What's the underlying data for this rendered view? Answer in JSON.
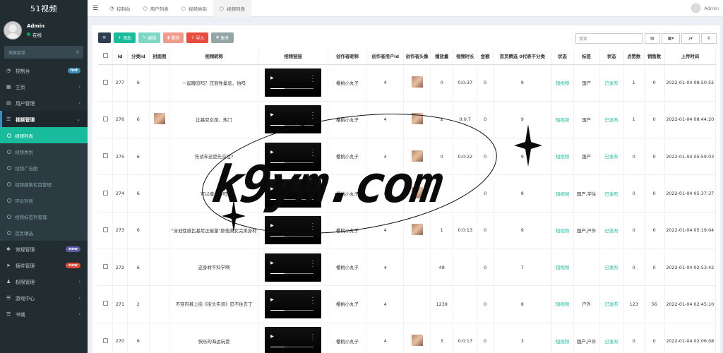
{
  "app": {
    "title": "51视频"
  },
  "user": {
    "name": "Admin",
    "status": "在线"
  },
  "sidebar": {
    "search_placeholder": "搜索菜单",
    "items": [
      {
        "label": "控制台",
        "badge": "hot",
        "icon": "dashboard-icon"
      },
      {
        "label": "主页",
        "icon": "home-icon"
      },
      {
        "label": "用户管理",
        "icon": "users-icon"
      },
      {
        "label": "视频管理",
        "icon": "list-icon"
      }
    ],
    "submenu": [
      "视频列表",
      "视频类别",
      "视频广告图",
      "视频搜索栏目管理",
      "评论列表",
      "视频标签列管理",
      "首页精选"
    ],
    "bottom_items": [
      {
        "label": "常规管理",
        "badge": "new"
      },
      {
        "label": "插件管理",
        "badge": "new"
      },
      {
        "label": "权限管理"
      },
      {
        "label": "游戏中心"
      },
      {
        "label": "书城"
      }
    ]
  },
  "topbar": {
    "tabs": [
      "控制台",
      "用户列表",
      "视频类别",
      "视频列表"
    ],
    "user": "Admin"
  },
  "toolbar": {
    "add": "添加",
    "edit": "编辑",
    "delete": "删除",
    "import": "导入",
    "more": "更多",
    "search_placeholder": "搜索"
  },
  "table": {
    "headers": [
      "Id",
      "分类id",
      "封面图",
      "视频昵称",
      "视频链接",
      "创作者昵称",
      "创作者用户id",
      "创作者头像",
      "播放量",
      "视频时长",
      "金额",
      "首页精选 0代表不分类",
      "状态",
      "标签",
      "状态",
      "点赞数",
      "销售数",
      "上传时间"
    ],
    "rows": [
      {
        "id": "277",
        "cat": "6",
        "cover": false,
        "title": "一起瞳览吗？压到性量息，怕吗",
        "creator": "樱桃小丸子",
        "uid": "4",
        "avatar": true,
        "plays": "0",
        "duration": "0:0:37",
        "amount": "0",
        "featured": "9",
        "status": "短视频",
        "tags": "国产",
        "pub": "已发布",
        "likes": "1",
        "sales": "0",
        "time": "2022-01-04 08:50:52"
      },
      {
        "id": "276",
        "cat": "6",
        "cover": true,
        "title": "比基尼女孩，热门",
        "creator": "樱桃小丸子",
        "uid": "4",
        "avatar": true,
        "plays": "2",
        "duration": "0:0:7",
        "amount": "0",
        "featured": "9",
        "status": "短视频",
        "tags": "国产",
        "pub": "已发布",
        "likes": "1",
        "sales": "0",
        "time": "2022-01-04 08:44:20"
      },
      {
        "id": "275",
        "cat": "6",
        "cover": false,
        "title": "先试车还是先交往?",
        "creator": "樱桃小丸子",
        "uid": "4",
        "avatar": true,
        "plays": "0",
        "duration": "0:0:22",
        "amount": "0",
        "featured": "9",
        "status": "短视频",
        "tags": "国产",
        "pub": "已发布",
        "likes": "0",
        "sales": "0",
        "time": "2022-01-04 05:59:03"
      },
      {
        "id": "274",
        "cat": "6",
        "cover": false,
        "title": "可以摸一下吗",
        "creator": "樱桃小丸子",
        "uid": "4",
        "avatar": true,
        "plays": "",
        "duration": "",
        "amount": "0",
        "featured": "8",
        "status": "短视频",
        "tags": "国产,学生",
        "pub": "已发布",
        "likes": "0",
        "sales": "0",
        "time": "2022-01-04 05:37:37"
      },
      {
        "id": "273",
        "cat": "6",
        "cover": false,
        "title": "\"泳池性感比基尼正能量\"颜值美女完美身材",
        "creator": "樱桃小丸子",
        "uid": "4",
        "avatar": true,
        "plays": "1",
        "duration": "0:0:13",
        "amount": "0",
        "featured": "9",
        "status": "短视频",
        "tags": "国产,户外",
        "pub": "已发布",
        "likes": "0",
        "sales": "0",
        "time": "2022-01-04 05:19:04"
      },
      {
        "id": "272",
        "cat": "6",
        "cover": false,
        "title": "这身材不科学啊",
        "creator": "樱桃小丸子",
        "uid": "4",
        "avatar": false,
        "plays": "48",
        "duration": "",
        "amount": "0",
        "featured": "7",
        "status": "短视频",
        "tags": "",
        "pub": "已发布",
        "likes": "0",
        "sales": "0",
        "time": "2022-01-04 02:53:42"
      },
      {
        "id": "271",
        "cat": "2",
        "cover": false,
        "title": "不穿内裤上街《街头实测》忍不住去了",
        "creator": "樱桃小丸子",
        "uid": "4",
        "avatar": false,
        "plays": "1239",
        "duration": "",
        "amount": "0",
        "featured": "8",
        "status": "短视频",
        "tags": "户外",
        "pub": "已发布",
        "likes": "123",
        "sales": "56",
        "time": "2022-01-04 02:45:10"
      },
      {
        "id": "270",
        "cat": "6",
        "cover": false,
        "title": "快乐的海边玩耍",
        "creator": "樱桃小丸子",
        "uid": "4",
        "avatar": true,
        "plays": "3",
        "duration": "0:0:17",
        "amount": "0",
        "featured": "3",
        "status": "短视频",
        "tags": "国产,户外",
        "pub": "已发布",
        "likes": "0",
        "sales": "0",
        "time": "2022-01-04 02:06:08"
      }
    ]
  },
  "watermark": {
    "text": "k9ym.com"
  },
  "colors": {
    "sidebar": "#222d32",
    "accent": "#18bc9c",
    "danger": "#e74c3c"
  }
}
